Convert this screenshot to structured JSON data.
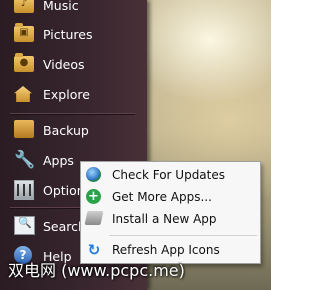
{
  "side_menu": {
    "items": [
      {
        "label": "Music",
        "icon": "music-folder-icon"
      },
      {
        "label": "Pictures",
        "icon": "pictures-folder-icon"
      },
      {
        "label": "Videos",
        "icon": "videos-folder-icon"
      },
      {
        "label": "Explore",
        "icon": "home-icon"
      },
      {
        "label": "Backup",
        "icon": "backup-icon"
      },
      {
        "label": "Apps",
        "icon": "wrench-icon"
      },
      {
        "label": "Options",
        "icon": "options-icon"
      },
      {
        "label": "Search",
        "icon": "search-icon"
      },
      {
        "label": "Help",
        "icon": "help-icon"
      }
    ]
  },
  "context_menu": {
    "items": [
      {
        "label": "Check For Updates",
        "icon": "globe-icon"
      },
      {
        "label": "Get More Apps...",
        "icon": "plus-icon"
      },
      {
        "label": "Install a New App",
        "icon": "install-icon"
      },
      {
        "label": "Refresh App Icons",
        "icon": "refresh-icon"
      }
    ]
  },
  "watermark": {
    "text": "双电网 (www.pcpc.me)"
  },
  "colors": {
    "side_menu_bg": "#3a2730",
    "menu_text": "#ffffff",
    "context_bg": "#f7f7f7"
  }
}
